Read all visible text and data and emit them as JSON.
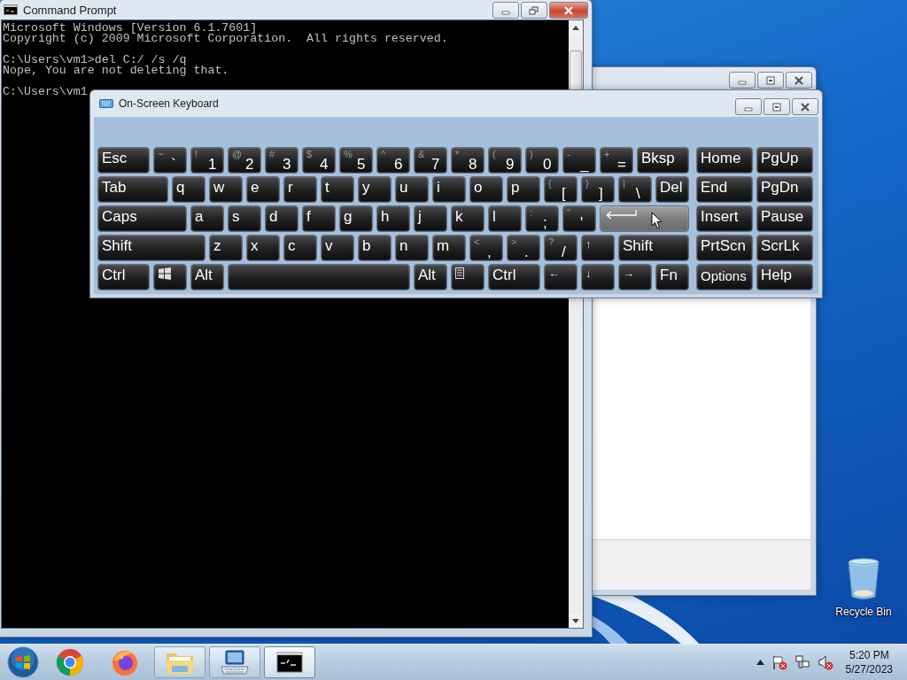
{
  "console_window": {
    "title": "Command Prompt",
    "blocks": [
      [
        "Microsoft Windows [Version 6.1.7601]",
        "Copyright (c) 2009 Microsoft Corporation.  All rights reserved."
      ],
      [
        "C:\\Users\\vm1>del C:/ /s /q",
        "Nope, You are not deleting that."
      ],
      [
        "C:\\Users\\vm1"
      ]
    ]
  },
  "keyboard_window": {
    "title": "On-Screen Keyboard",
    "rows": [
      {
        "keys": [
          {
            "kind": "text",
            "label": "Esc",
            "hover": false
          },
          {
            "kind": "char",
            "shift": "~",
            "label": "`",
            "hover": false
          },
          {
            "kind": "char",
            "shift": "!",
            "label": "1",
            "hover": false
          },
          {
            "kind": "char",
            "shift": "@",
            "label": "2",
            "hover": false
          },
          {
            "kind": "char",
            "shift": "#",
            "label": "3",
            "hover": false
          },
          {
            "kind": "char",
            "shift": "$",
            "label": "4",
            "hover": false
          },
          {
            "kind": "char",
            "shift": "%",
            "label": "5",
            "hover": false
          },
          {
            "kind": "char",
            "shift": "^",
            "label": "6",
            "hover": false
          },
          {
            "kind": "char",
            "shift": "&",
            "label": "7",
            "hover": false
          },
          {
            "kind": "char",
            "shift": "*",
            "label": "8",
            "hover": false
          },
          {
            "kind": "char",
            "shift": "(",
            "label": "9",
            "hover": false
          },
          {
            "kind": "char",
            "shift": ")",
            "label": "0",
            "hover": false
          },
          {
            "kind": "char",
            "shift": "-",
            "label": "_",
            "hover": false
          },
          {
            "kind": "char",
            "shift": "+",
            "label": "=",
            "hover": false
          },
          {
            "kind": "text",
            "label": "Bksp",
            "hover": false
          }
        ]
      },
      {
        "keys": [
          {
            "kind": "text",
            "label": "Tab",
            "hover": false
          },
          {
            "kind": "letter",
            "label": "q",
            "hover": false
          },
          {
            "kind": "letter",
            "label": "w",
            "hover": false
          },
          {
            "kind": "letter",
            "label": "e",
            "hover": false
          },
          {
            "kind": "letter",
            "label": "r",
            "hover": false
          },
          {
            "kind": "letter",
            "label": "t",
            "hover": false
          },
          {
            "kind": "letter",
            "label": "y",
            "hover": false
          },
          {
            "kind": "letter",
            "label": "u",
            "hover": false
          },
          {
            "kind": "letter",
            "label": "i",
            "hover": false
          },
          {
            "kind": "letter",
            "label": "o",
            "hover": false
          },
          {
            "kind": "letter",
            "label": "p",
            "hover": false
          },
          {
            "kind": "char",
            "shift": "{",
            "label": "[",
            "hover": false
          },
          {
            "kind": "char",
            "shift": "}",
            "label": "]",
            "hover": false
          },
          {
            "kind": "char",
            "shift": "|",
            "label": "\\",
            "hover": false
          },
          {
            "kind": "text",
            "label": "Del",
            "hover": false
          }
        ]
      },
      {
        "keys": [
          {
            "kind": "text",
            "label": "Caps",
            "hover": false
          },
          {
            "kind": "letter",
            "label": "a",
            "hover": false
          },
          {
            "kind": "letter",
            "label": "s",
            "hover": false
          },
          {
            "kind": "letter",
            "label": "d",
            "hover": false
          },
          {
            "kind": "letter",
            "label": "f",
            "hover": false
          },
          {
            "kind": "letter",
            "label": "g",
            "hover": false
          },
          {
            "kind": "letter",
            "label": "h",
            "hover": false
          },
          {
            "kind": "letter",
            "label": "j",
            "hover": false
          },
          {
            "kind": "letter",
            "label": "k",
            "hover": false
          },
          {
            "kind": "letter",
            "label": "l",
            "hover": false
          },
          {
            "kind": "char",
            "shift": ":",
            "label": ";",
            "hover": false
          },
          {
            "kind": "char",
            "shift": "\"",
            "label": "'",
            "hover": false
          },
          {
            "kind": "enter",
            "hover": true
          }
        ]
      },
      {
        "keys": [
          {
            "kind": "text",
            "label": "Shift",
            "hover": false
          },
          {
            "kind": "letter",
            "label": "z",
            "hover": false
          },
          {
            "kind": "letter",
            "label": "x",
            "hover": false
          },
          {
            "kind": "letter",
            "label": "c",
            "hover": false
          },
          {
            "kind": "letter",
            "label": "v",
            "hover": false
          },
          {
            "kind": "letter",
            "label": "b",
            "hover": false
          },
          {
            "kind": "letter",
            "label": "n",
            "hover": false
          },
          {
            "kind": "letter",
            "label": "m",
            "hover": false
          },
          {
            "kind": "char",
            "shift": "<",
            "label": ",",
            "hover": false
          },
          {
            "kind": "char",
            "shift": ">",
            "label": ".",
            "hover": false
          },
          {
            "kind": "char",
            "shift": "?",
            "label": "/",
            "hover": false
          },
          {
            "kind": "arrow",
            "label": "↑",
            "hover": false
          },
          {
            "kind": "text",
            "label": "Shift",
            "hover": false
          }
        ]
      },
      {
        "keys": [
          {
            "kind": "text",
            "label": "Ctrl",
            "hover": false
          },
          {
            "kind": "windows",
            "hover": false
          },
          {
            "kind": "text",
            "label": "Alt",
            "hover": false
          },
          {
            "kind": "space",
            "hover": false
          },
          {
            "kind": "text",
            "label": "Alt",
            "hover": false
          },
          {
            "kind": "menu",
            "hover": false
          },
          {
            "kind": "text",
            "label": "Ctrl",
            "hover": false
          },
          {
            "kind": "arrow",
            "label": "←",
            "hover": false
          },
          {
            "kind": "arrow",
            "label": "↓",
            "hover": false
          },
          {
            "kind": "arrow",
            "label": "→",
            "hover": false
          },
          {
            "kind": "text",
            "label": "Fn",
            "hover": false
          }
        ]
      }
    ],
    "nav_rows": [
      [
        "Home",
        "PgUp"
      ],
      [
        "End",
        "PgDn"
      ],
      [
        "Insert",
        "Pause"
      ],
      [
        "PrtScn",
        "ScrLk"
      ],
      [
        "Options",
        "Help"
      ]
    ]
  },
  "desktop_icons": [
    {
      "label": "Recycle Bin"
    }
  ],
  "taskbar": {
    "buttons": [
      {
        "kind": "start",
        "open": false,
        "active": false
      },
      {
        "kind": "chrome",
        "open": false,
        "active": false
      },
      {
        "kind": "firefox",
        "open": false,
        "active": false
      },
      {
        "kind": "folder",
        "open": true,
        "active": false
      },
      {
        "kind": "keyboard",
        "open": true,
        "active": false
      },
      {
        "kind": "console",
        "open": true,
        "active": true
      }
    ],
    "time": "5:20 PM",
    "date": "5/27/2023"
  }
}
